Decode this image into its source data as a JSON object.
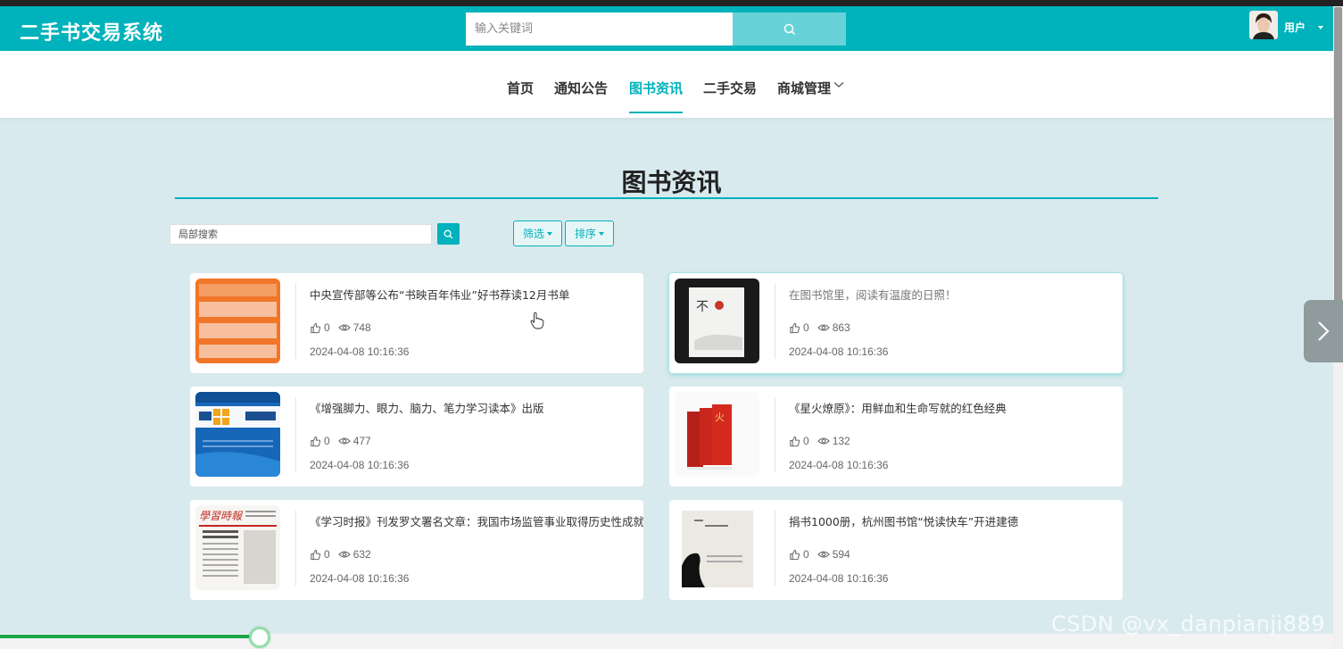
{
  "app": {
    "title": "二手书交易系统"
  },
  "header": {
    "search_placeholder": "输入关键词",
    "username": "用户",
    "accent_color": "#00b2bb"
  },
  "nav": {
    "items": [
      {
        "label": "首页"
      },
      {
        "label": "通知公告"
      },
      {
        "label": "图书资讯",
        "active": true
      },
      {
        "label": "二手交易"
      },
      {
        "label": "商城管理",
        "has_dropdown": true
      }
    ]
  },
  "page": {
    "title": "图书资讯",
    "local_search_placeholder": "局部搜索",
    "filter_label": "筛选",
    "sort_label": "排序"
  },
  "articles": [
    {
      "title": "中央宣传部等公布“书映百年伟业”好书荐读12月书单",
      "likes": "0",
      "views": "748",
      "date": "2024-04-08 10:16:36"
    },
    {
      "title": "在图书馆里，阅读有温度的日照！",
      "likes": "0",
      "views": "863",
      "date": "2024-04-08 10:16:36"
    },
    {
      "title": "《增强脚力、眼力、脑力、笔力学习读本》出版",
      "likes": "0",
      "views": "477",
      "date": "2024-04-08 10:16:36"
    },
    {
      "title": "《星火燎原》：用鲜血和生命写就的红色经典",
      "likes": "0",
      "views": "132",
      "date": "2024-04-08 10:16:36"
    },
    {
      "title": "《学习时报》刊发罗文署名文章：我国市场监管事业取得历史性成就",
      "likes": "0",
      "views": "632",
      "date": "2024-04-08 10:16:36"
    },
    {
      "title": "捐书1000册，杭州图书馆“悦读快车”开进建德",
      "likes": "0",
      "views": "594",
      "date": "2024-04-08 10:16:36"
    }
  ],
  "video_progress": 0.195,
  "watermark": "CSDN @vx_danpianji889"
}
